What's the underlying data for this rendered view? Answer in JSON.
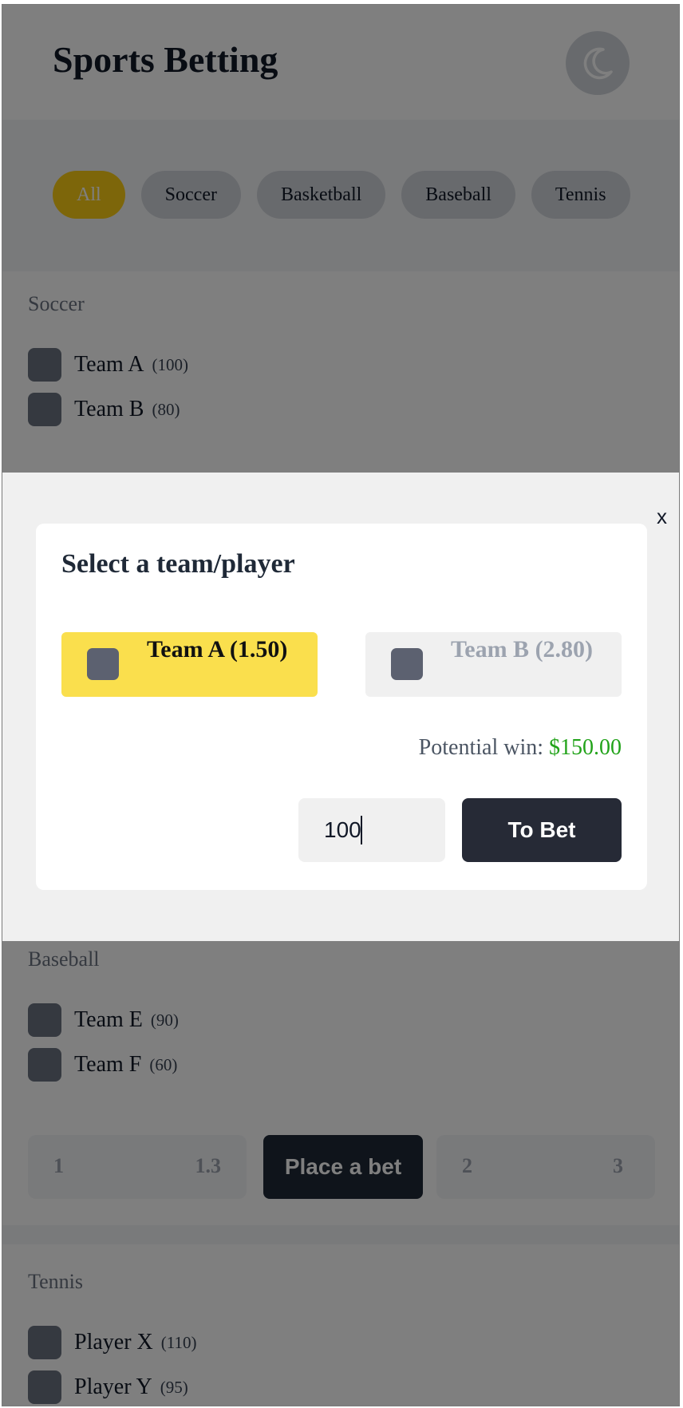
{
  "header": {
    "title": "Sports Betting",
    "theme_toggle_icon": "moon-icon"
  },
  "categories": [
    "All",
    "Soccer",
    "Basketball",
    "Baseball",
    "Tennis"
  ],
  "active_category": "All",
  "sections": {
    "soccer": {
      "title": "Soccer",
      "items": [
        {
          "name": "Team A",
          "count": "(100)"
        },
        {
          "name": "Team B",
          "count": "(80)"
        }
      ]
    },
    "baseball": {
      "title": "Baseball",
      "items": [
        {
          "name": "Team E",
          "count": "(90)"
        },
        {
          "name": "Team F",
          "count": "(60)"
        }
      ],
      "bet_row": {
        "left_label": "1",
        "left_odds": "1.3",
        "place_bet_label": "Place a bet",
        "right_label": "2",
        "right_odds": "3"
      }
    },
    "tennis": {
      "title": "Tennis",
      "items": [
        {
          "name": "Player X",
          "count": "(110)"
        },
        {
          "name": "Player Y",
          "count": "(95)"
        }
      ]
    }
  },
  "modal": {
    "close_label": "x",
    "title": "Select a team/player",
    "choices": [
      {
        "label": "Team A (1.50)",
        "selected": true
      },
      {
        "label": "Team B (2.80)",
        "selected": false
      }
    ],
    "potential_win_label": "Potential win:",
    "potential_win_amount": "$150.00",
    "stake_value": "100",
    "to_bet_label": "To Bet"
  },
  "colors": {
    "accent_yellow": "#facc15",
    "dark_button": "#262a36",
    "win_green": "#22a31a"
  }
}
